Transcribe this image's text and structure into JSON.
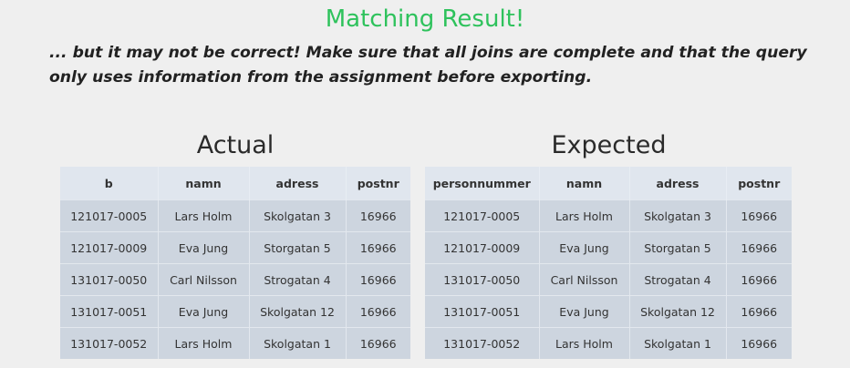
{
  "header": {
    "title": "Matching Result!",
    "title_color": "#2ec25c",
    "warning": "... but it may not be correct! Make sure that all joins are complete and that the query only uses information from the assignment before exporting."
  },
  "actual": {
    "title": "Actual",
    "columns": [
      "b",
      "namn",
      "adress",
      "postnr"
    ],
    "rows": [
      [
        "121017-0005",
        "Lars Holm",
        "Skolgatan 3",
        "16966"
      ],
      [
        "121017-0009",
        "Eva Jung",
        "Storgatan 5",
        "16966"
      ],
      [
        "131017-0050",
        "Carl Nilsson",
        "Strogatan 4",
        "16966"
      ],
      [
        "131017-0051",
        "Eva Jung",
        "Skolgatan 12",
        "16966"
      ],
      [
        "131017-0052",
        "Lars Holm",
        "Skolgatan 1",
        "16966"
      ]
    ]
  },
  "expected": {
    "title": "Expected",
    "columns": [
      "personnummer",
      "namn",
      "adress",
      "postnr"
    ],
    "rows": [
      [
        "121017-0005",
        "Lars Holm",
        "Skolgatan 3",
        "16966"
      ],
      [
        "121017-0009",
        "Eva Jung",
        "Storgatan 5",
        "16966"
      ],
      [
        "131017-0050",
        "Carl Nilsson",
        "Strogatan 4",
        "16966"
      ],
      [
        "131017-0051",
        "Eva Jung",
        "Skolgatan 12",
        "16966"
      ],
      [
        "131017-0052",
        "Lars Holm",
        "Skolgatan 1",
        "16966"
      ]
    ]
  }
}
